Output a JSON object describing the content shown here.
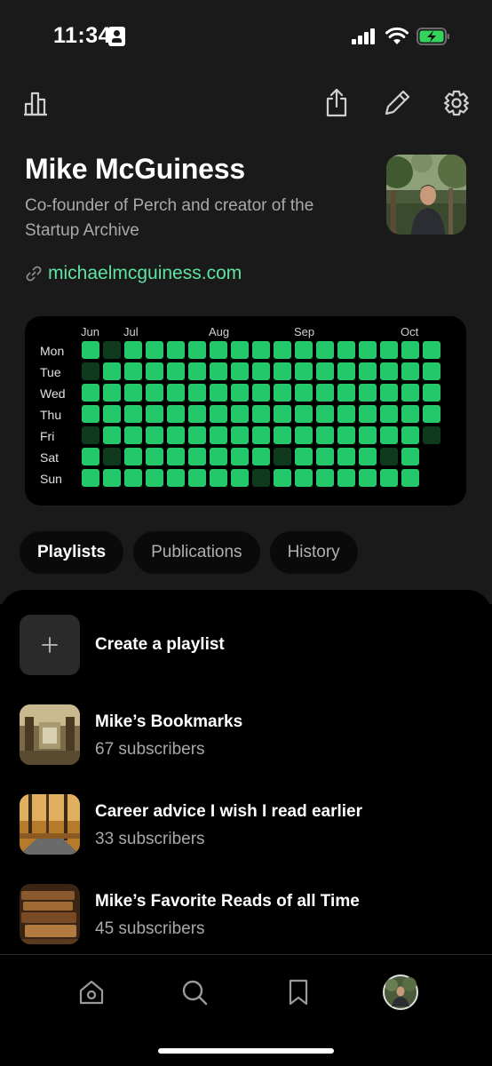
{
  "status_bar": {
    "time": "11:34"
  },
  "profile": {
    "name": "Mike McGuiness",
    "bio": "Co-founder of Perch and creator of the Startup Archive",
    "link": "michaelmcguiness.com"
  },
  "heatmap": {
    "months": [
      "Jun",
      "Jul",
      "Aug",
      "Sep",
      "Oct"
    ],
    "days": [
      "Mon",
      "Tue",
      "Wed",
      "Thu",
      "Fri",
      "Sat",
      "Sun"
    ],
    "colors": {
      "active": "#22c86a",
      "inactive": "#0f3a1e"
    },
    "weeks": [
      [
        1,
        0,
        1,
        1,
        0,
        1,
        1
      ],
      [
        0,
        1,
        1,
        1,
        1,
        0,
        1
      ],
      [
        1,
        1,
        1,
        1,
        1,
        1,
        1
      ],
      [
        1,
        1,
        1,
        1,
        1,
        1,
        1
      ],
      [
        1,
        1,
        1,
        1,
        1,
        1,
        1
      ],
      [
        1,
        1,
        1,
        1,
        1,
        1,
        1
      ],
      [
        1,
        1,
        1,
        1,
        1,
        1,
        1
      ],
      [
        1,
        1,
        1,
        1,
        1,
        1,
        1
      ],
      [
        1,
        1,
        1,
        1,
        1,
        1,
        0
      ],
      [
        1,
        1,
        1,
        1,
        1,
        0,
        1
      ],
      [
        1,
        1,
        1,
        1,
        1,
        1,
        1
      ],
      [
        1,
        1,
        1,
        1,
        1,
        1,
        1
      ],
      [
        1,
        1,
        1,
        1,
        1,
        1,
        1
      ],
      [
        1,
        1,
        1,
        1,
        1,
        1,
        1
      ],
      [
        1,
        1,
        1,
        1,
        1,
        0,
        1
      ],
      [
        1,
        1,
        1,
        1,
        1,
        1,
        1
      ],
      [
        1,
        1,
        1,
        1,
        0,
        null,
        null
      ]
    ]
  },
  "tabs": [
    {
      "label": "Playlists",
      "active": true
    },
    {
      "label": "Publications",
      "active": false
    },
    {
      "label": "History",
      "active": false
    }
  ],
  "create_playlist": {
    "label": "Create a playlist",
    "icon": "plus-icon"
  },
  "playlists": [
    {
      "title": "Mike’s Bookmarks",
      "subscribers": "67 subscribers"
    },
    {
      "title": "Career advice I wish I read earlier",
      "subscribers": "33 subscribers"
    },
    {
      "title": "Mike’s Favorite Reads of all Time",
      "subscribers": "45 subscribers"
    }
  ],
  "nav": [
    "home-icon",
    "search-icon",
    "bookmark-icon",
    "profile-avatar"
  ],
  "header_icons": [
    "stats-icon",
    "share-icon",
    "edit-icon",
    "settings-icon"
  ]
}
